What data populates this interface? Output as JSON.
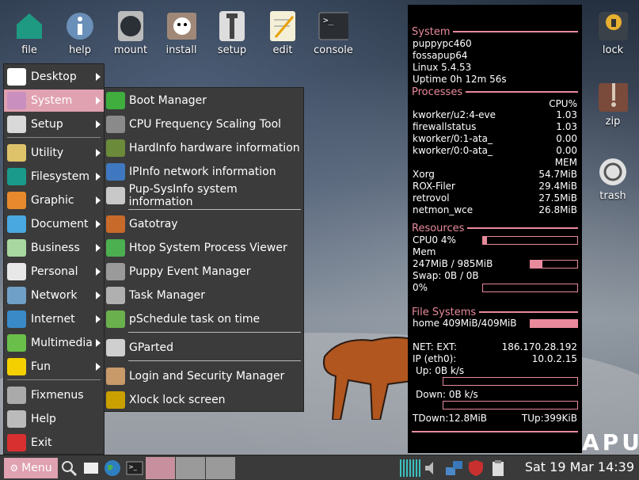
{
  "desktop_icons": [
    {
      "label": "file",
      "icon": "file-house-icon"
    },
    {
      "label": "help",
      "icon": "help-info-icon"
    },
    {
      "label": "mount",
      "icon": "drive-mount-icon"
    },
    {
      "label": "install",
      "icon": "install-puppy-icon"
    },
    {
      "label": "setup",
      "icon": "wrench-setup-icon"
    },
    {
      "label": "edit",
      "icon": "notepad-edit-icon"
    },
    {
      "label": "console",
      "icon": "terminal-icon"
    },
    {
      "label": "lock",
      "icon": "padlock-icon"
    },
    {
      "label": "zip",
      "icon": "zip-archive-icon"
    },
    {
      "label": "trash",
      "icon": "trash-recycle-icon"
    }
  ],
  "main_menu": {
    "items": [
      {
        "label": "Desktop",
        "has_sub": true,
        "color": "#ffffff"
      },
      {
        "label": "System",
        "has_sub": true,
        "color": "#c98fbf",
        "active": true
      },
      {
        "label": "Setup",
        "has_sub": true,
        "color": "#d9d9d9"
      },
      {
        "label": "Utility",
        "has_sub": true,
        "color": "#dfc36a"
      },
      {
        "label": "Filesystem",
        "has_sub": true,
        "color": "#1a9a8a"
      },
      {
        "label": "Graphic",
        "has_sub": true,
        "color": "#e7892c"
      },
      {
        "label": "Document",
        "has_sub": true,
        "color": "#4aa8e0"
      },
      {
        "label": "Business",
        "has_sub": true,
        "color": "#a8d8a0"
      },
      {
        "label": "Personal",
        "has_sub": true,
        "color": "#e8e8e8"
      },
      {
        "label": "Network",
        "has_sub": true,
        "color": "#6fa0c8"
      },
      {
        "label": "Internet",
        "has_sub": true,
        "color": "#3a8ac8"
      },
      {
        "label": "Multimedia",
        "has_sub": true,
        "color": "#6abf4a"
      },
      {
        "label": "Fun",
        "has_sub": true,
        "color": "#f4d000"
      },
      {
        "label": "Fixmenus",
        "has_sub": false,
        "color": "#aaaaaa"
      },
      {
        "label": "Help",
        "has_sub": false,
        "color": "#bbbbbb"
      },
      {
        "label": "Exit",
        "has_sub": false,
        "color": "#d83030"
      }
    ]
  },
  "system_submenu": {
    "items": [
      {
        "label": "Boot Manager",
        "color": "#3fae3f"
      },
      {
        "label": "CPU Frequency Scaling Tool",
        "color": "#8a8a8a"
      },
      {
        "label": "HardInfo hardware information",
        "color": "#6b8a3a"
      },
      {
        "label": "IPInfo network information",
        "color": "#3f78c0"
      },
      {
        "label": "Pup-SysInfo system information",
        "color": "#c8c8c8"
      },
      {
        "label": "Gatotray",
        "color": "#c86a2a"
      },
      {
        "label": "Htop System Process Viewer",
        "color": "#4caf50"
      },
      {
        "label": "Puppy Event Manager",
        "color": "#9a9a9a"
      },
      {
        "label": "Task Manager",
        "color": "#b0b0b0"
      },
      {
        "label": "pSchedule task on time",
        "color": "#6ab04c"
      },
      {
        "label": "GParted",
        "color": "#cfcfcf"
      },
      {
        "label": "Login and Security Manager",
        "color": "#c89a6a"
      },
      {
        "label": "Xlock lock screen",
        "color": "#caa000"
      }
    ]
  },
  "conky": {
    "system_header": "System",
    "hostname": "puppypc460",
    "distro": "fossapup64",
    "kernel": "Linux 5.4.53",
    "uptime": "Uptime 0h 12m 56s",
    "processes_header": "Processes",
    "cpu_col": "CPU%",
    "cpu_procs": [
      {
        "name": "kworker/u2:4-eve",
        "value": "1.03"
      },
      {
        "name": "firewallstatus",
        "value": "1.03"
      },
      {
        "name": "kworker/0:1-ata_",
        "value": "0.00"
      },
      {
        "name": "kworker/0:0-ata_",
        "value": "0.00"
      }
    ],
    "mem_col": "MEM",
    "mem_procs": [
      {
        "name": "Xorg",
        "value": "54.7MiB"
      },
      {
        "name": "ROX-Filer",
        "value": "29.4MiB"
      },
      {
        "name": "retrovol",
        "value": "27.5MiB"
      },
      {
        "name": "netmon_wce",
        "value": "26.8MiB"
      }
    ],
    "resources_header": "Resources",
    "cpu0": "CPU0 4%",
    "cpu0_pct": 0.04,
    "mem_label": "Mem",
    "mem_usage": "247MiB / 985MiB",
    "mem_pct": 0.25,
    "swap": "Swap: 0B  / 0B",
    "swap_pct_label": "0%",
    "swap_pct": 0,
    "fs_header": "File Systems",
    "home": "home 409MiB/409MiB",
    "home_pct": 1.0,
    "net_ext_label": "NET: EXT:",
    "net_ext_ip": "186.170.28.192",
    "ip_eth_label": "IP (eth0):",
    "ip_eth": "10.0.2.15",
    "up": "Up: 0B  k/s",
    "down": "Down: 0B  k/s",
    "tdown": "TDown:12.8MiB",
    "tup": "TUp:399KiB"
  },
  "wallpaper_text": "APU",
  "taskbar": {
    "menu_label": "Menu",
    "clock": "Sat 19 Mar 14:39",
    "accent": "#e0a1b1"
  }
}
